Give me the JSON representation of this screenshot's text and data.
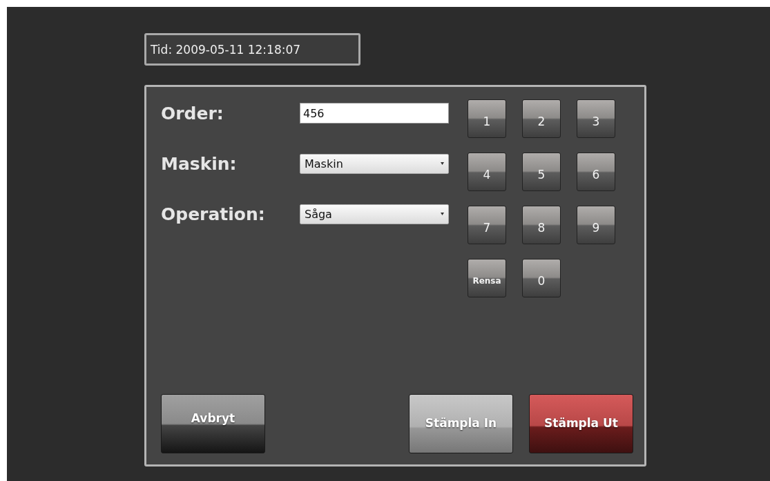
{
  "time_display": "Tid: 2009-05-11 12:18:07",
  "form": [
    {
      "kind": "text",
      "label": "Order:",
      "value": "456"
    },
    {
      "kind": "select",
      "label": "Maskin:",
      "value": "Maskin"
    },
    {
      "kind": "select",
      "label": "Operation:",
      "value": "Såga"
    }
  ],
  "keypad": [
    {
      "kind": "digit",
      "label": "1"
    },
    {
      "kind": "digit",
      "label": "2"
    },
    {
      "kind": "digit",
      "label": "3"
    },
    {
      "kind": "digit",
      "label": "4"
    },
    {
      "kind": "digit",
      "label": "5"
    },
    {
      "kind": "digit",
      "label": "6"
    },
    {
      "kind": "digit",
      "label": "7"
    },
    {
      "kind": "digit",
      "label": "8"
    },
    {
      "kind": "digit",
      "label": "9"
    },
    {
      "kind": "clear",
      "label": "Rensa"
    },
    {
      "kind": "digit",
      "label": "0"
    }
  ],
  "actions": [
    {
      "kind": "dark",
      "label": "Avbryt"
    },
    {
      "kind": "spacer"
    },
    {
      "kind": "light",
      "label": "Stämpla In"
    },
    {
      "kind": "red",
      "label": "Stämpla Ut"
    }
  ]
}
